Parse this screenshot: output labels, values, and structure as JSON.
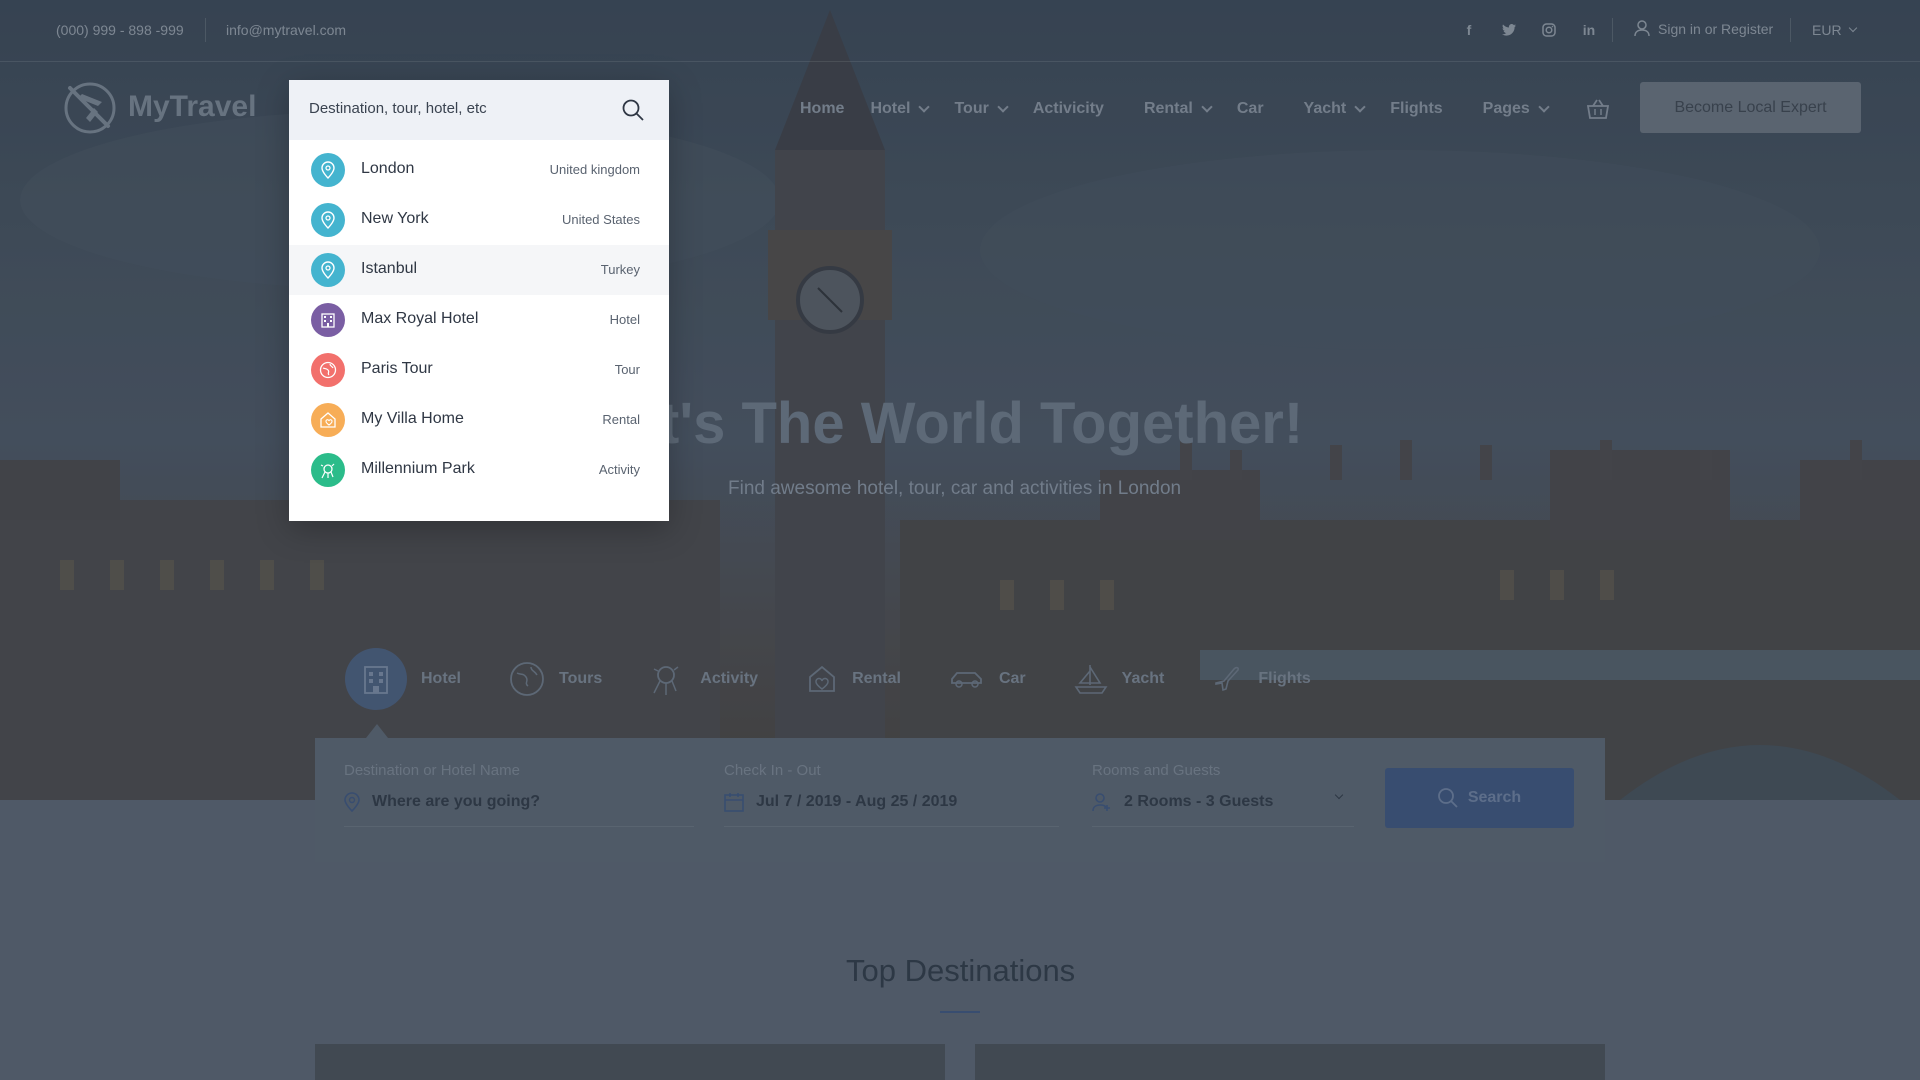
{
  "topbar": {
    "phone": "(000) 999 - 898 -999",
    "email": "info@mytravel.com",
    "socials": [
      "facebook-icon",
      "twitter-icon",
      "instagram-icon",
      "linkedin-icon"
    ],
    "signin": "Sign in or Register",
    "currency": "EUR"
  },
  "logo": {
    "text": "MyTravel"
  },
  "nav": {
    "items": [
      {
        "label": "Home",
        "dropdown": false
      },
      {
        "label": "Hotel",
        "dropdown": true
      },
      {
        "label": "Tour",
        "dropdown": true
      },
      {
        "label": "Activicity",
        "dropdown": false
      },
      {
        "label": "Rental",
        "dropdown": true
      },
      {
        "label": "Car",
        "dropdown": false
      },
      {
        "label": "Yacht",
        "dropdown": true
      },
      {
        "label": "Flights",
        "dropdown": false
      },
      {
        "label": "Pages",
        "dropdown": true
      }
    ],
    "become_label": "Become Local Expert"
  },
  "hero": {
    "title": "t's The World Together!",
    "subtitle": "Find awesome hotel, tour, car and activities in London"
  },
  "categories": [
    {
      "label": "Hotel",
      "icon": "hotel-icon",
      "active": true
    },
    {
      "label": "Tours",
      "icon": "tours-icon",
      "active": false
    },
    {
      "label": "Activity",
      "icon": "activity-icon",
      "active": false
    },
    {
      "label": "Rental",
      "icon": "rental-icon",
      "active": false
    },
    {
      "label": "Car",
      "icon": "car-icon",
      "active": false
    },
    {
      "label": "Yacht",
      "icon": "yacht-icon",
      "active": false
    },
    {
      "label": "Flights",
      "icon": "flights-icon",
      "active": false
    }
  ],
  "search_form": {
    "destination_label": "Destination or Hotel Name",
    "destination_placeholder": "Where are you going?",
    "dates_label": "Check In - Out",
    "dates_value": "Jul 7 / 2019 - Aug 25 / 2019",
    "guests_label": "Rooms and Guests",
    "guests_value": "2 Rooms - 3 Guests",
    "search_label": "Search"
  },
  "top_destinations": {
    "title": "Top Destinations"
  },
  "dropdown": {
    "placeholder": "Destination, tour, hotel, etc",
    "items": [
      {
        "name": "London",
        "type": "United kingdom",
        "icon": "location-pin-icon",
        "color": "#44b4cf"
      },
      {
        "name": "New York",
        "type": "United States",
        "icon": "location-pin-icon",
        "color": "#44b4cf"
      },
      {
        "name": "Istanbul",
        "type": "Turkey",
        "icon": "location-pin-icon",
        "color": "#44b4cf"
      },
      {
        "name": "Max Royal Hotel",
        "type": "Hotel",
        "icon": "hotel-icon",
        "color": "#7a5ea3"
      },
      {
        "name": "Paris Tour",
        "type": "Tour",
        "icon": "tour-icon",
        "color": "#f2706c"
      },
      {
        "name": "My Villa Home",
        "type": "Rental",
        "icon": "villa-icon",
        "color": "#f7ad57"
      },
      {
        "name": "Millennium Park",
        "type": "Activity",
        "icon": "activity-icon",
        "color": "#2bbc8a"
      }
    ]
  },
  "colors": {
    "accent": "#3e5680",
    "pin": "#44b4cf",
    "hotel": "#7a5ea3",
    "tour": "#f2706c",
    "rental": "#f7ad57",
    "activity": "#2bbc8a"
  }
}
